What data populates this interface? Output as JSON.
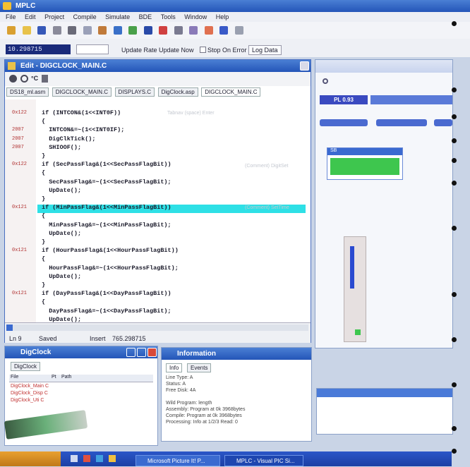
{
  "app": {
    "title": "MPLC"
  },
  "menu": [
    "File",
    "Edit",
    "Project",
    "Compile",
    "Simulate",
    "BDE",
    "Tools",
    "Window",
    "Help"
  ],
  "toolbar2": {
    "counter": "10.298715",
    "update_rate_label": "Update Rate",
    "update_now_label": "Update Now",
    "stop_on_error_label": "Stop On Error",
    "last_button_label": "Log Data"
  },
  "editor": {
    "title": "Edit - DIGCLOCK_MAIN.C",
    "tabs": [
      "DS18_ml.asm",
      "DIGCLOCK_MAIN.C",
      "DISPLAYS.C",
      "DigClock.asp",
      "DIGCLOCK_MAIN.C"
    ],
    "lines": [
      {
        "num": "0x122",
        "code": "if (INTCON&(1<<INT0F))"
      },
      {
        "num": "",
        "code": "{"
      },
      {
        "num": "2007",
        "code": "  INTCON&=~(1<<INT0IF);"
      },
      {
        "num": "2007",
        "code": "  DigClkTick();"
      },
      {
        "num": "2007",
        "code": "  SHIOOF();"
      },
      {
        "num": "",
        "code": "}"
      },
      {
        "num": "0x122",
        "code": "if (SecPassFlag&(1<<SecPassFlagBit))"
      },
      {
        "num": "",
        "code": "{"
      },
      {
        "num": "",
        "code": "  SecPassFlag&=~(1<<SecPassFlagBit);"
      },
      {
        "num": "",
        "code": "  UpDate();"
      },
      {
        "num": "",
        "code": "}"
      },
      {
        "num": "0x121",
        "code": "if (MinPassFlag&(1<<MinPassFlagBit))"
      },
      {
        "num": "",
        "code": "{"
      },
      {
        "num": "",
        "code": "  MinPassFlag&=~(1<<MinPassFlagBit);"
      },
      {
        "num": "",
        "code": "  UpDate();"
      },
      {
        "num": "",
        "code": "}"
      },
      {
        "num": "0x121",
        "code": "if (HourPassFlag&(1<<HourPassFlagBit))"
      },
      {
        "num": "",
        "code": "{"
      },
      {
        "num": "",
        "code": "  HourPassFlag&=~(1<<HourPassFlagBit);"
      },
      {
        "num": "",
        "code": "  UpDate();"
      },
      {
        "num": "",
        "code": "}"
      },
      {
        "num": "0x121",
        "code": "if (DayPassFlag&(1<<DayPassFlagBit))"
      },
      {
        "num": "",
        "code": "{"
      },
      {
        "num": "",
        "code": "  DayPassFlag&=~(1<<DayPassFlagBit);"
      },
      {
        "num": "",
        "code": "  UpDate();"
      }
    ],
    "status": {
      "line": "Ln 9",
      "saved": "Saved",
      "insert": "Insert",
      "position": "765.298715"
    }
  },
  "right_panel": {
    "tab_label": "PL 0.93",
    "device_label": "SB"
  },
  "digclock_panel": {
    "title": "DigClock",
    "tab": "DigClock",
    "columns": [
      "File",
      "Pt",
      "Path"
    ],
    "rows": [
      "DigClock_Main C",
      "DigClock_Disp C",
      "DigClock_Uti C"
    ]
  },
  "info_panel": {
    "title": "Information",
    "tabs": [
      "Info",
      "Events"
    ],
    "lines": [
      "Line Type: A",
      "Status: A",
      "Free Disk: 4A",
      "",
      "Wild Program: length",
      "Assembly: Program at 0k 3968bytes",
      "Compile: Program at 0k 3968bytes",
      "Processing: Info at 1/2/3 Read: 0"
    ]
  },
  "taskbar": [
    "Microsoft Picture It! P...",
    "MPLC - Visual PIC Si..."
  ],
  "colors": {
    "accent": "#2455b8",
    "highlight": "#2ee0e6",
    "green": "#3ec64e"
  }
}
